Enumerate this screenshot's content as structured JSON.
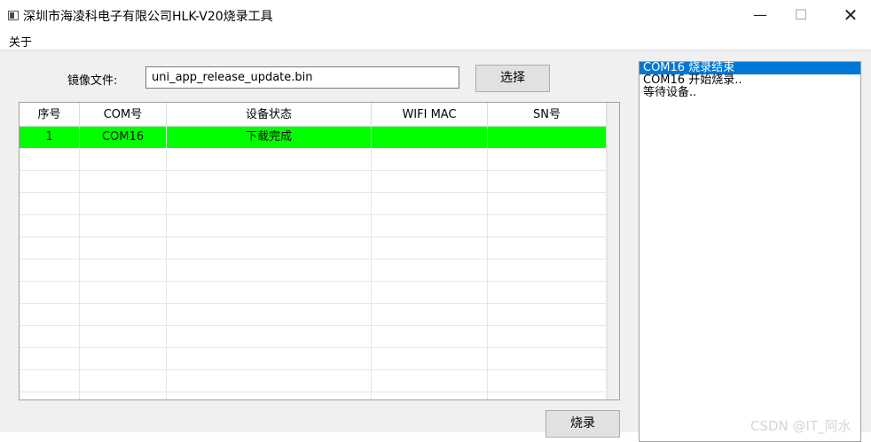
{
  "window": {
    "title": "深圳市海凌科电子有限公司HLK-V20烧录工具",
    "controls": {
      "minimize": "—",
      "maximize": "☐",
      "close": "✕"
    }
  },
  "menu": {
    "about": "关于"
  },
  "file": {
    "label": "镜像文件:",
    "value": "uni_app_release_update.bin",
    "select_button": "选择"
  },
  "table": {
    "columns": [
      "序号",
      "COM号",
      "设备状态",
      "WIFI MAC",
      "SN号"
    ],
    "rows": [
      {
        "index": "1",
        "com": "COM16",
        "status": "下载完成",
        "wifi_mac": "",
        "sn": ""
      }
    ]
  },
  "burn_button": "烧录",
  "log": {
    "lines": [
      "COM16 烧录结束",
      "COM16 开始烧录..",
      "等待设备.."
    ],
    "selected": 0
  },
  "watermark": "CSDN @IT_阿水",
  "colors": {
    "success_row": "#00ff00",
    "selection": "#0078d7"
  }
}
